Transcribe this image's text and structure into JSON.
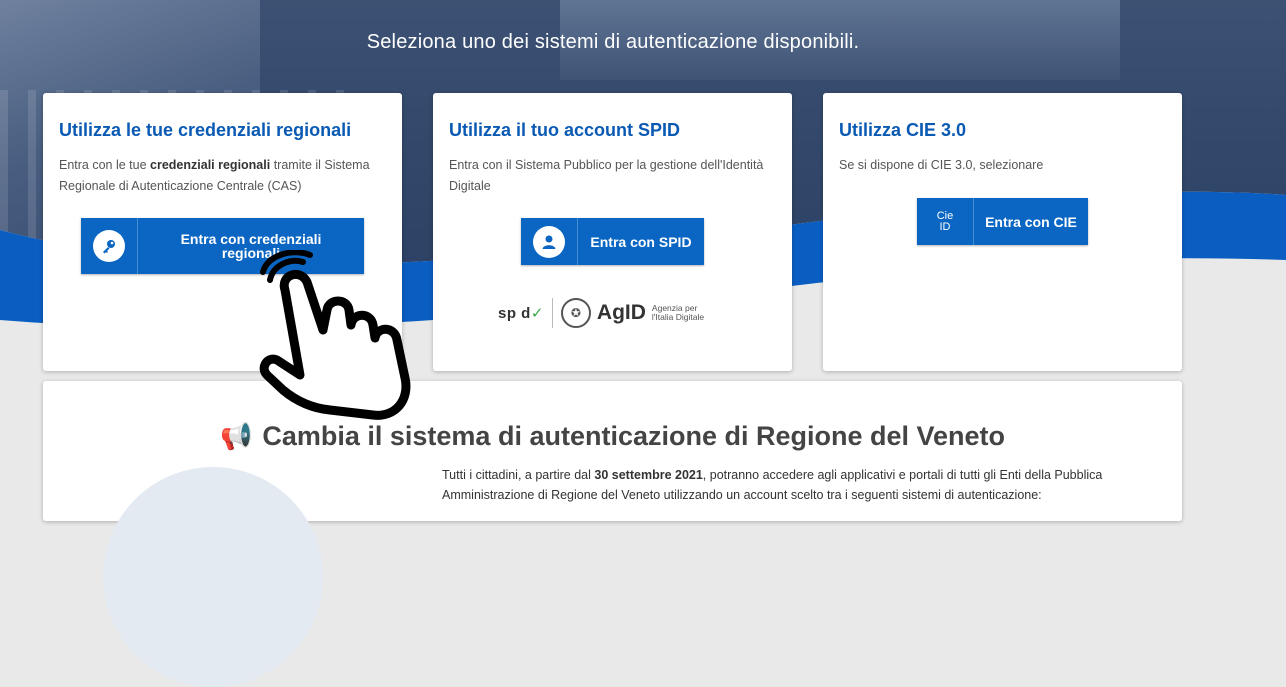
{
  "header": {
    "subtitle": "Seleziona uno dei sistemi di autenticazione disponibili."
  },
  "cards": [
    {
      "title": "Utilizza le tue credenziali regionali",
      "desc_prefix": "Entra con le tue ",
      "desc_bold": "credenziali regionali",
      "desc_suffix": " tramite il Sistema Regionale di Autenticazione Centrale (CAS)",
      "button_line1": "Entra con credenziali",
      "button_line2": "regionali",
      "icon": "key-icon"
    },
    {
      "title": "Utilizza il tuo account SPID",
      "desc": "Entra con il Sistema Pubblico per la gestione dell'Identità Digitale",
      "button": "Entra con SPID",
      "icon": "user-icon",
      "logo_spid": "sp d",
      "logo_agid": "AgID",
      "logo_agid_sub": "Agenzia per l'Italia Digitale"
    },
    {
      "title": "Utilizza CIE 3.0",
      "desc": "Se si dispone di CIE 3.0, selezionare",
      "button": "Entra con CIE",
      "icon_text_1": "Cie",
      "icon_text_2": "ID"
    }
  ],
  "info": {
    "title": "Cambia il sistema di autenticazione di Regione del Veneto",
    "text_prefix": "Tutti i cittadini, a partire dal ",
    "text_bold": "30 settembre 2021",
    "text_suffix": ", potranno accedere agli applicativi e portali di tutti gli Enti della Pubblica Amministrazione di Regione del Veneto utilizzando un account scelto tra i seguenti sistemi di autenticazione:"
  },
  "colors": {
    "accent": "#0a66c2",
    "title_blue": "#0a5ab4",
    "hero_wave": "#0a5ec2"
  }
}
